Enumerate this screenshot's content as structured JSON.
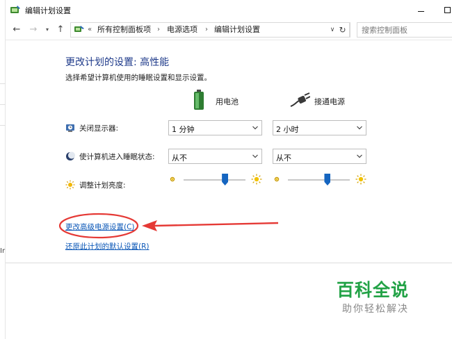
{
  "window": {
    "title": "编辑计划设置",
    "controls": {
      "minimize": "minimize",
      "maximize": "maximize"
    }
  },
  "address_bar": {
    "overflow": "«",
    "crumbs": [
      "所有控制面板项",
      "电源选项",
      "编辑计划设置"
    ],
    "search_placeholder": "搜索控制面板"
  },
  "main": {
    "title": "更改计划的设置: 高性能",
    "description": "选择希望计算机使用的睡眠设置和显示设置。",
    "columns": {
      "battery": "用电池",
      "plugged": "接通电源"
    },
    "rows": {
      "display_off": {
        "label": "关闭显示器:",
        "battery": "1 分钟",
        "plugged": "2 小时"
      },
      "sleep": {
        "label": "使计算机进入睡眠状态:",
        "battery": "从不",
        "plugged": "从不"
      },
      "brightness": {
        "label": "调整计划亮度:",
        "battery_level": 0.67,
        "plugged_level": 0.64
      }
    },
    "links": {
      "advanced": "更改高级电源设置(C)",
      "restore": "还原此计划的默认设置(R)"
    }
  },
  "watermark": {
    "main": "百科全说",
    "sub": "助你轻松解决"
  },
  "colors": {
    "title_blue": "#1e3a8a",
    "link_blue": "#0b57b7",
    "slider_blue": "#1565c0",
    "annotation_red": "#e53935",
    "watermark_green": "#22a246"
  }
}
